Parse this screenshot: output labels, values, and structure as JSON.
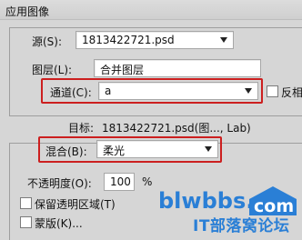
{
  "dialog": {
    "title": "应用图像"
  },
  "source": {
    "source_label": "源(S):",
    "source_value": "1813422721.psd",
    "layer_label": "图层(L):",
    "layer_value": "合并图层",
    "channel_label": "通道(C):",
    "channel_value": "a",
    "invert_label": "反相"
  },
  "target": {
    "label": "目标:",
    "value": "1813422721.psd(图..., Lab)"
  },
  "blending": {
    "blend_label": "混合(B):",
    "blend_value": "柔光",
    "opacity_label": "不透明度(O):",
    "opacity_value": "100",
    "opacity_unit": "%",
    "preserve_label": "保留透明区域(T)",
    "mask_label": "蒙版(K)..."
  },
  "watermark": {
    "logo_text": "blwbbs.com",
    "site_text": "IT部落窝论坛"
  },
  "colors": {
    "highlight": "#cc1f1f",
    "watermark": "#2a7fd6"
  }
}
